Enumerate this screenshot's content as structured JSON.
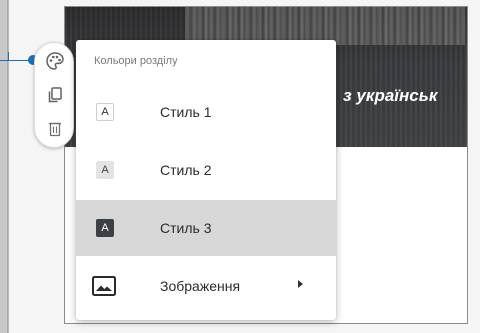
{
  "header": {
    "title": "з українськ"
  },
  "toolbar": {
    "buttons": [
      {
        "name": "palette",
        "icon": "palette-icon"
      },
      {
        "name": "duplicate",
        "icon": "copy-icon"
      },
      {
        "name": "delete",
        "icon": "trash-icon"
      }
    ]
  },
  "menu": {
    "heading": "Кольори розділу",
    "items": [
      {
        "swatch": "A",
        "label": "Стиль 1",
        "selected": false
      },
      {
        "swatch": "A",
        "label": "Стиль 2",
        "selected": false
      },
      {
        "swatch": "A",
        "label": "Стиль 3",
        "selected": true
      },
      {
        "icon": "image-icon",
        "label": "Зображення",
        "has_submenu": true
      }
    ]
  },
  "colors": {
    "callout": "#1f6fb5",
    "selected_row": "#d7d7d7",
    "style3_swatch": "#3c3f44"
  }
}
